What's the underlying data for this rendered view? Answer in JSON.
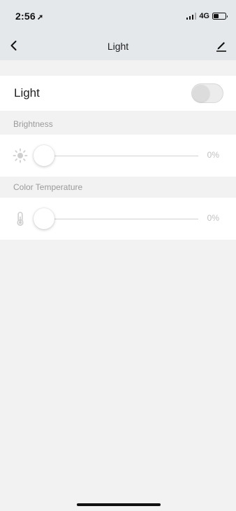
{
  "status_bar": {
    "time": "2:56",
    "location_icon": "location-arrow-icon",
    "network": "4G",
    "battery_level": 0.45
  },
  "nav": {
    "title": "Light",
    "back_icon": "chevron-left-icon",
    "edit_icon": "pencil-icon"
  },
  "light_row": {
    "label": "Light",
    "toggle_on": false
  },
  "sections": {
    "brightness": {
      "header": "Brightness",
      "icon": "sun-icon",
      "value": "0%",
      "level": 0
    },
    "color_temperature": {
      "header": "Color Temperature",
      "icon": "thermometer-icon",
      "value": "0%",
      "level": 0
    }
  },
  "colors": {
    "header_bg": "#e4e8ea",
    "page_bg": "#f2f2f2",
    "card_bg": "#ffffff",
    "muted_text": "#9a9a9a"
  }
}
